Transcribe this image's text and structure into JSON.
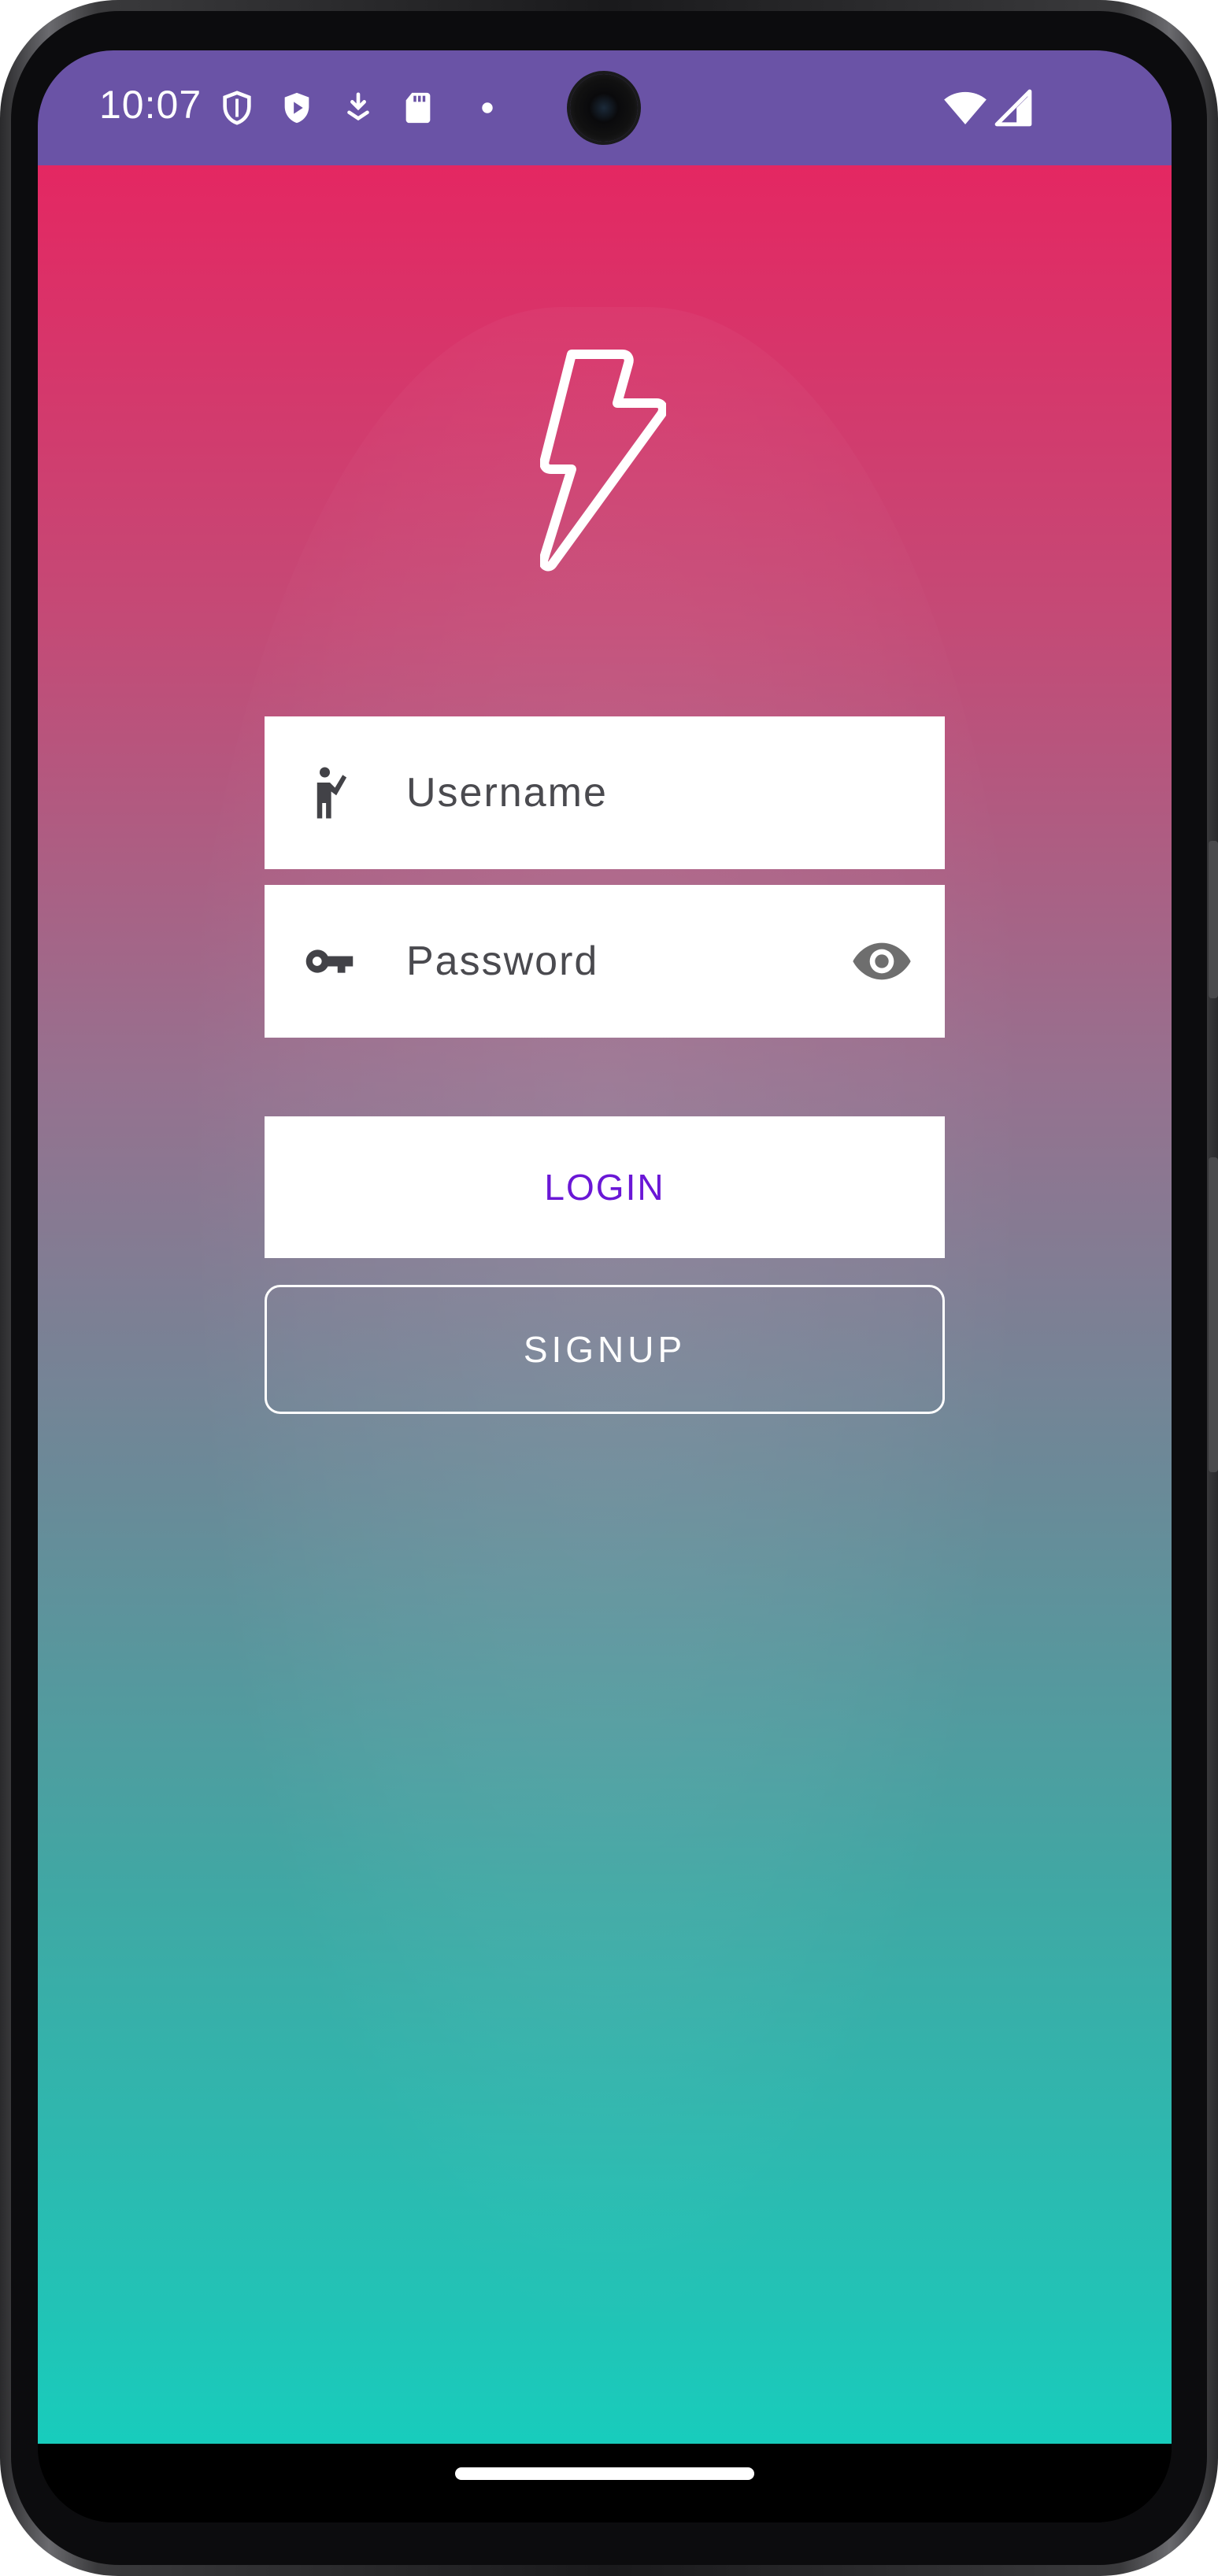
{
  "status_bar": {
    "time": "10:07",
    "left_icons": [
      "shield-outline-icon",
      "shield-play-icon",
      "download-icon",
      "sd-card-icon",
      "dot-icon"
    ],
    "right_icons": [
      "wifi-icon",
      "cellular-signal-icon"
    ],
    "background": "#6a53a6"
  },
  "app": {
    "logo": "lightning-bolt-icon",
    "gradient_top": "#e42762",
    "gradient_bottom": "#18ccbc",
    "username_field": {
      "placeholder": "Username",
      "value": "",
      "icon": "person-waving-icon"
    },
    "password_field": {
      "placeholder": "Password",
      "value": "",
      "icon": "key-icon",
      "toggle_icon": "eye-icon"
    },
    "login_label": "LOGIN",
    "login_color": "#6a17d6",
    "signup_label": "SIGNUP"
  }
}
